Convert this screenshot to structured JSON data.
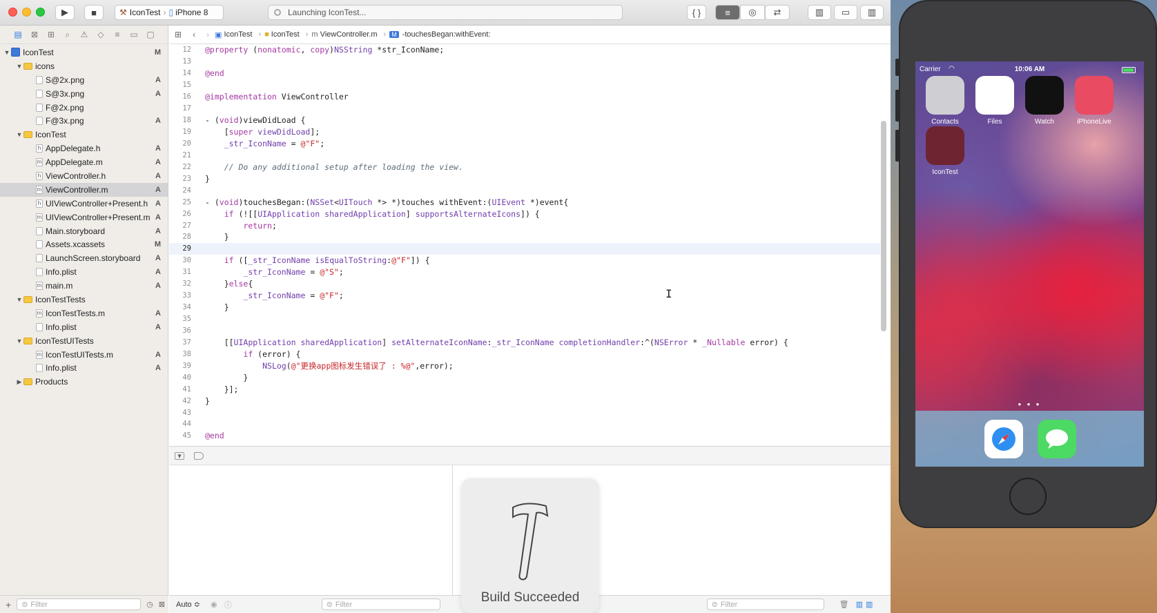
{
  "toolbar": {
    "scheme": "IconTest",
    "device": "iPhone 8",
    "activity": "Launching IconTest..."
  },
  "navigator": {
    "tree": [
      {
        "label": "IconTest",
        "type": "proj",
        "indent": 0,
        "badge": "M",
        "disclosure": "▼"
      },
      {
        "label": "icons",
        "type": "folder",
        "indent": 1,
        "badge": "",
        "disclosure": "▼"
      },
      {
        "label": "S@2x.png",
        "type": "file",
        "indent": 2,
        "badge": "A",
        "disclosure": ""
      },
      {
        "label": "S@3x.png",
        "type": "file",
        "indent": 2,
        "badge": "A",
        "disclosure": ""
      },
      {
        "label": "F@2x.png",
        "type": "file",
        "indent": 2,
        "badge": "",
        "disclosure": ""
      },
      {
        "label": "F@3x.png",
        "type": "file",
        "indent": 2,
        "badge": "A",
        "disclosure": ""
      },
      {
        "label": "IconTest",
        "type": "folder",
        "indent": 1,
        "badge": "",
        "disclosure": "▼"
      },
      {
        "label": "AppDelegate.h",
        "type": "file",
        "indent": 2,
        "badge": "A",
        "disclosure": "",
        "glyph": "h"
      },
      {
        "label": "AppDelegate.m",
        "type": "file",
        "indent": 2,
        "badge": "A",
        "disclosure": "",
        "glyph": "m"
      },
      {
        "label": "ViewController.h",
        "type": "file",
        "indent": 2,
        "badge": "A",
        "disclosure": "",
        "glyph": "h"
      },
      {
        "label": "ViewController.m",
        "type": "file",
        "indent": 2,
        "badge": "A",
        "disclosure": "",
        "glyph": "m",
        "selected": true
      },
      {
        "label": "UIViewController+Present.h",
        "type": "file",
        "indent": 2,
        "badge": "A",
        "disclosure": "",
        "glyph": "h"
      },
      {
        "label": "UIViewController+Present.m",
        "type": "file",
        "indent": 2,
        "badge": "A",
        "disclosure": "",
        "glyph": "m"
      },
      {
        "label": "Main.storyboard",
        "type": "file",
        "indent": 2,
        "badge": "A",
        "disclosure": ""
      },
      {
        "label": "Assets.xcassets",
        "type": "file",
        "indent": 2,
        "badge": "M",
        "disclosure": ""
      },
      {
        "label": "LaunchScreen.storyboard",
        "type": "file",
        "indent": 2,
        "badge": "A",
        "disclosure": ""
      },
      {
        "label": "Info.plist",
        "type": "file",
        "indent": 2,
        "badge": "A",
        "disclosure": ""
      },
      {
        "label": "main.m",
        "type": "file",
        "indent": 2,
        "badge": "A",
        "disclosure": "",
        "glyph": "m"
      },
      {
        "label": "IconTestTests",
        "type": "folder",
        "indent": 1,
        "badge": "",
        "disclosure": "▼"
      },
      {
        "label": "IconTestTests.m",
        "type": "file",
        "indent": 2,
        "badge": "A",
        "disclosure": "",
        "glyph": "m"
      },
      {
        "label": "Info.plist",
        "type": "file",
        "indent": 2,
        "badge": "A",
        "disclosure": ""
      },
      {
        "label": "IconTestUITests",
        "type": "folder",
        "indent": 1,
        "badge": "",
        "disclosure": "▼"
      },
      {
        "label": "IconTestUITests.m",
        "type": "file",
        "indent": 2,
        "badge": "A",
        "disclosure": "",
        "glyph": "m"
      },
      {
        "label": "Info.plist",
        "type": "file",
        "indent": 2,
        "badge": "A",
        "disclosure": ""
      },
      {
        "label": "Products",
        "type": "folder",
        "indent": 1,
        "badge": "",
        "disclosure": "▶"
      }
    ],
    "filter_placeholder": "Filter"
  },
  "jumpbar": {
    "project": "IconTest",
    "group": "IconTest",
    "file": "ViewController.m",
    "method_badge": "M",
    "method": "-touchesBegan:withEvent:"
  },
  "code": [
    {
      "n": "12",
      "html": "<span class=\"kw\">@property</span> (<span class=\"kw\">nonatomic</span>, <span class=\"kw\">copy</span>)<span class=\"ty\">NSString</span> *str_IconName;"
    },
    {
      "n": "13",
      "html": ""
    },
    {
      "n": "14",
      "html": "<span class=\"kw\">@end</span>"
    },
    {
      "n": "15",
      "html": ""
    },
    {
      "n": "16",
      "html": "<span class=\"kw\">@implementation</span> ViewController"
    },
    {
      "n": "17",
      "html": ""
    },
    {
      "n": "18",
      "html": "- (<span class=\"kw\">void</span>)viewDidLoad {"
    },
    {
      "n": "19",
      "html": "    [<span class=\"kw\">super</span> <span class=\"ty\">viewDidLoad</span>];"
    },
    {
      "n": "20",
      "html": "    <span class=\"ty\">_str_IconName</span> = <span class=\"str\">@\"F\"</span>;"
    },
    {
      "n": "21",
      "html": ""
    },
    {
      "n": "22",
      "html": "    <span class=\"cm\">// Do any additional setup after loading the view.</span>"
    },
    {
      "n": "23",
      "html": "}"
    },
    {
      "n": "24",
      "html": ""
    },
    {
      "n": "25",
      "html": "- (<span class=\"kw\">void</span>)touchesBegan:(<span class=\"ty\">NSSet</span>&lt;<span class=\"ty\">UITouch</span> *&gt; *)touches withEvent:(<span class=\"ty\">UIEvent</span> *)event{"
    },
    {
      "n": "26",
      "html": "    <span class=\"kw\">if</span> (![[<span class=\"ty\">UIApplication</span> <span class=\"ty\">sharedApplication</span>] <span class=\"ty\">supportsAlternateIcons</span>]) {"
    },
    {
      "n": "27",
      "html": "        <span class=\"kw\">return</span>;"
    },
    {
      "n": "28",
      "html": "    }"
    },
    {
      "n": "29",
      "html": "",
      "current": true
    },
    {
      "n": "30",
      "html": "    <span class=\"kw\">if</span> ([<span class=\"ty\">_str_IconName</span> <span class=\"ty\">isEqualToString</span>:<span class=\"str\">@\"F\"</span>]) {"
    },
    {
      "n": "31",
      "html": "        <span class=\"ty\">_str_IconName</span> = <span class=\"str\">@\"S\"</span>;"
    },
    {
      "n": "32",
      "html": "    }<span class=\"kw\">else</span>{"
    },
    {
      "n": "33",
      "html": "        <span class=\"ty\">_str_IconName</span> = <span class=\"str\">@\"F\"</span>;"
    },
    {
      "n": "34",
      "html": "    }"
    },
    {
      "n": "35",
      "html": ""
    },
    {
      "n": "36",
      "html": ""
    },
    {
      "n": "37",
      "html": "    [[<span class=\"ty\">UIApplication</span> <span class=\"ty\">sharedApplication</span>] <span class=\"ty\">setAlternateIconName</span>:<span class=\"ty\">_str_IconName</span> <span class=\"ty\">completionHandler</span>:^(<span class=\"ty\">NSError</span> * <span class=\"kw\">_Nullable</span> error) {"
    },
    {
      "n": "38",
      "html": "        <span class=\"kw\">if</span> (error) {"
    },
    {
      "n": "39",
      "html": "            <span class=\"ty\">NSLog</span>(<span class=\"str\">@\"更换app图标发生错误了 : %@\"</span>,error);"
    },
    {
      "n": "40",
      "html": "        }"
    },
    {
      "n": "41",
      "html": "    }];"
    },
    {
      "n": "42",
      "html": "}"
    },
    {
      "n": "43",
      "html": ""
    },
    {
      "n": "44",
      "html": ""
    },
    {
      "n": "45",
      "html": "<span class=\"kw\">@end</span>"
    }
  ],
  "debug": {
    "auto_label": "Auto ≎",
    "variables_filter": "Filter",
    "console_filter": "Filter"
  },
  "hud": {
    "label": "Build Succeeded"
  },
  "simulator": {
    "carrier": "Carrier",
    "time": "10:06 AM",
    "apps": [
      {
        "label": "Contacts",
        "icon": "contacts-icon",
        "color": "#cfcfd3"
      },
      {
        "label": "Files",
        "icon": "files-icon",
        "color": "#ffffff"
      },
      {
        "label": "Watch",
        "icon": "watch-icon",
        "color": "#111111"
      },
      {
        "label": "iPhoneLive",
        "icon": "iphonelive-icon",
        "color": "#e94b63"
      },
      {
        "label": "IconTest",
        "icon": "icontest-icon",
        "color": "#6e2431"
      }
    ],
    "dock": [
      {
        "icon": "safari-icon",
        "color": "#ffffff"
      },
      {
        "icon": "messages-icon",
        "color": "#4cd964"
      }
    ]
  }
}
